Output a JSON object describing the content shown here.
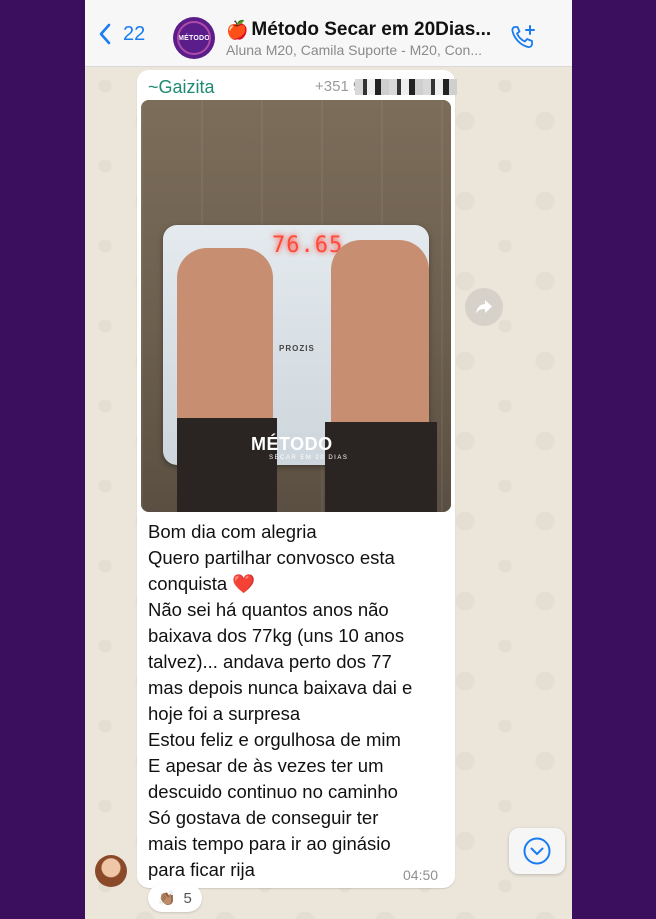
{
  "header": {
    "back_count": "22",
    "title": "Método Secar em 20Dias...",
    "title_emoji": "🍎",
    "subtitle": "Aluna M20, Camila Suporte - M20, Con...",
    "avatar_text": "MÉTODO"
  },
  "message": {
    "sender": "~Gaizita",
    "phone_prefix": "+351 9",
    "photo": {
      "scale_reading": "76.65",
      "scale_brand": "PROZIS",
      "watermark": "MÉTODO",
      "watermark_sub": "SECAR EM 20 DIAS"
    },
    "lines": [
      "Bom dia com alegria",
      "Quero partilhar convosco esta",
      "conquista ❤️",
      "Não sei há quantos anos não",
      "baixava dos 77kg (uns 10 anos",
      "talvez)... andava perto dos 77",
      "mas depois nunca baixava dai e",
      "hoje foi a surpresa",
      "Estou feliz e orgulhosa de mim",
      "E apesar de às vezes ter um",
      "descuido continuo no caminho",
      "Só gostava de conseguir ter",
      "mais tempo para ir ao ginásio",
      "para ficar rija"
    ],
    "time": "04:50",
    "reaction": {
      "emoji": "👏🏽",
      "count": "5"
    }
  },
  "icons": {
    "back": "chevron-left-icon",
    "call": "phone-add-icon",
    "forward": "forward-arrow-icon",
    "scroll": "chevron-down-circle-icon"
  },
  "colors": {
    "accent": "#1a7cf2",
    "sender": "#1f8a70",
    "outer_background": "#3b0f5e"
  }
}
